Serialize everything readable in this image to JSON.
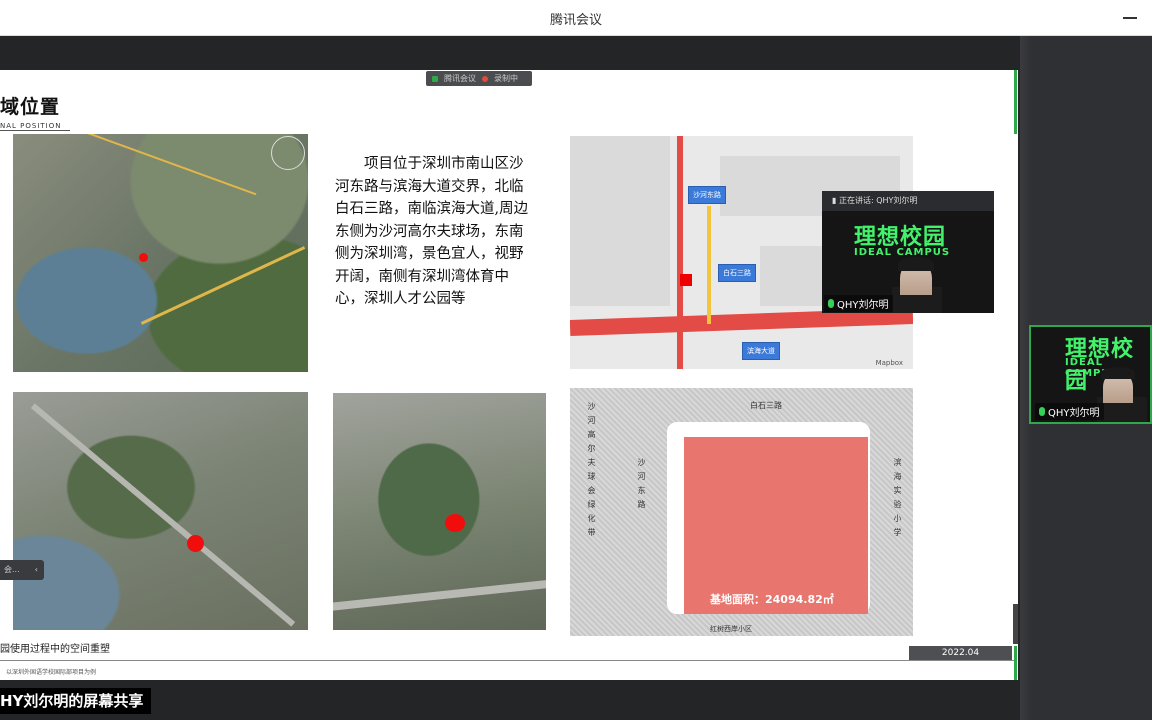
{
  "window": {
    "title": "腾讯会议"
  },
  "share_bar": {
    "app": "腾讯会议",
    "status": "录制中"
  },
  "slide": {
    "title": "区域位置",
    "title_visible": "域位置",
    "subtitle": "NAL POSITION",
    "description": "项目位于深圳市南山区沙河东路与滨海大道交界，北临白石三路，南临滨海大道,周边东侧为沙河高尔夫球场，东南侧为深圳湾，景色宜人，视野开阔，南侧有深圳湾体育中心，深圳人才公园等",
    "map_labels": {
      "shahe": "沙河东路",
      "baishi": "白石三路",
      "binhai": "滨海大道",
      "attribution": "Mapbox"
    },
    "plan": {
      "top_road": "白石三路",
      "left_text": "沙河高尔夫球会绿化带",
      "left_road": "沙河东路",
      "right_text": "滨海实验小学",
      "area_label": "基地面积：24094.82㎡",
      "bottom_road": "红树西岸小区"
    },
    "footer": "园使用过程中的空间重塑",
    "footer_small": "以深圳外国语学校国际部项目为例",
    "date": "2022.04",
    "sidebar_tab": "会..."
  },
  "tiles": {
    "speaker": {
      "status": "正在讲话: QHY刘尔明",
      "brand_cn": "理想校园",
      "brand_en": "IDEAL CAMPUS",
      "name": "QHY刘尔明"
    },
    "self": {
      "brand_cn": "理想校园",
      "brand_en": "IDEAL CAMPUS",
      "name": "QHY刘尔明"
    }
  },
  "screen_share_label": "HY刘尔明的屏幕共享",
  "colors": {
    "accent": "#2ea84a",
    "marker": "#f20d0d",
    "brand_green": "#42f26b"
  }
}
